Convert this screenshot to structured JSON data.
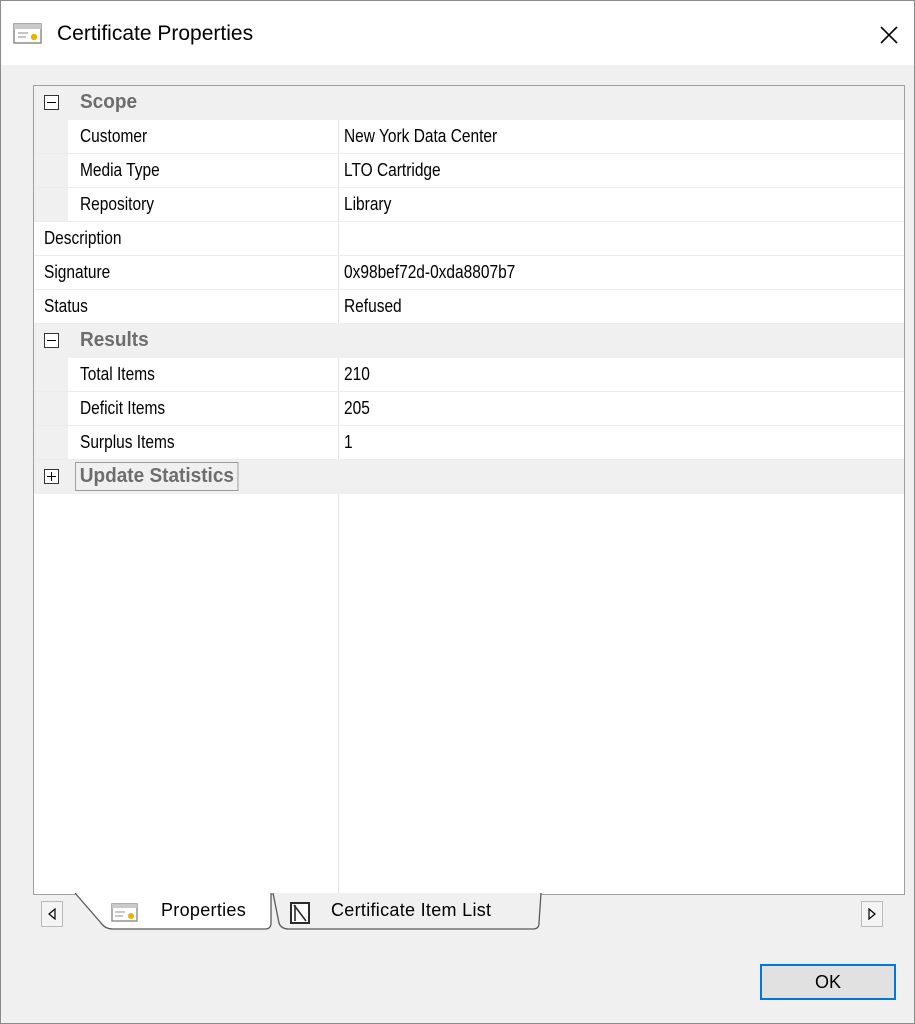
{
  "window": {
    "title": "Certificate Properties",
    "close_glyph": "✕"
  },
  "grid": {
    "categories": {
      "scope": {
        "label": "Scope",
        "expanded": true
      },
      "results": {
        "label": "Results",
        "expanded": true
      },
      "update": {
        "label": "Update Statistics",
        "expanded": false
      }
    },
    "rows": {
      "customer": {
        "label": "Customer",
        "value": "New York Data Center"
      },
      "media_type": {
        "label": "Media Type",
        "value": "LTO Cartridge"
      },
      "repository": {
        "label": "Repository",
        "value": "Library"
      },
      "description": {
        "label": "Description",
        "value": ""
      },
      "signature": {
        "label": "Signature",
        "value": "0x98bef72d-0xda8807b7"
      },
      "status": {
        "label": "Status",
        "value": "Refused"
      },
      "total_items": {
        "label": "Total Items",
        "value": "210"
      },
      "deficit_items": {
        "label": "Deficit Items",
        "value": "205"
      },
      "surplus_items": {
        "label": "Surplus Items",
        "value": "1"
      }
    }
  },
  "tabs": [
    {
      "label": "Properties",
      "icon": "properties-icon",
      "active": true
    },
    {
      "label": "Certificate Item List",
      "icon": "item-list-icon",
      "active": false
    }
  ],
  "buttons": {
    "ok": "OK"
  },
  "colors": {
    "accent": "#0078d7",
    "category_text": "#6d6d6d",
    "gutter": "#f0f0f0"
  }
}
